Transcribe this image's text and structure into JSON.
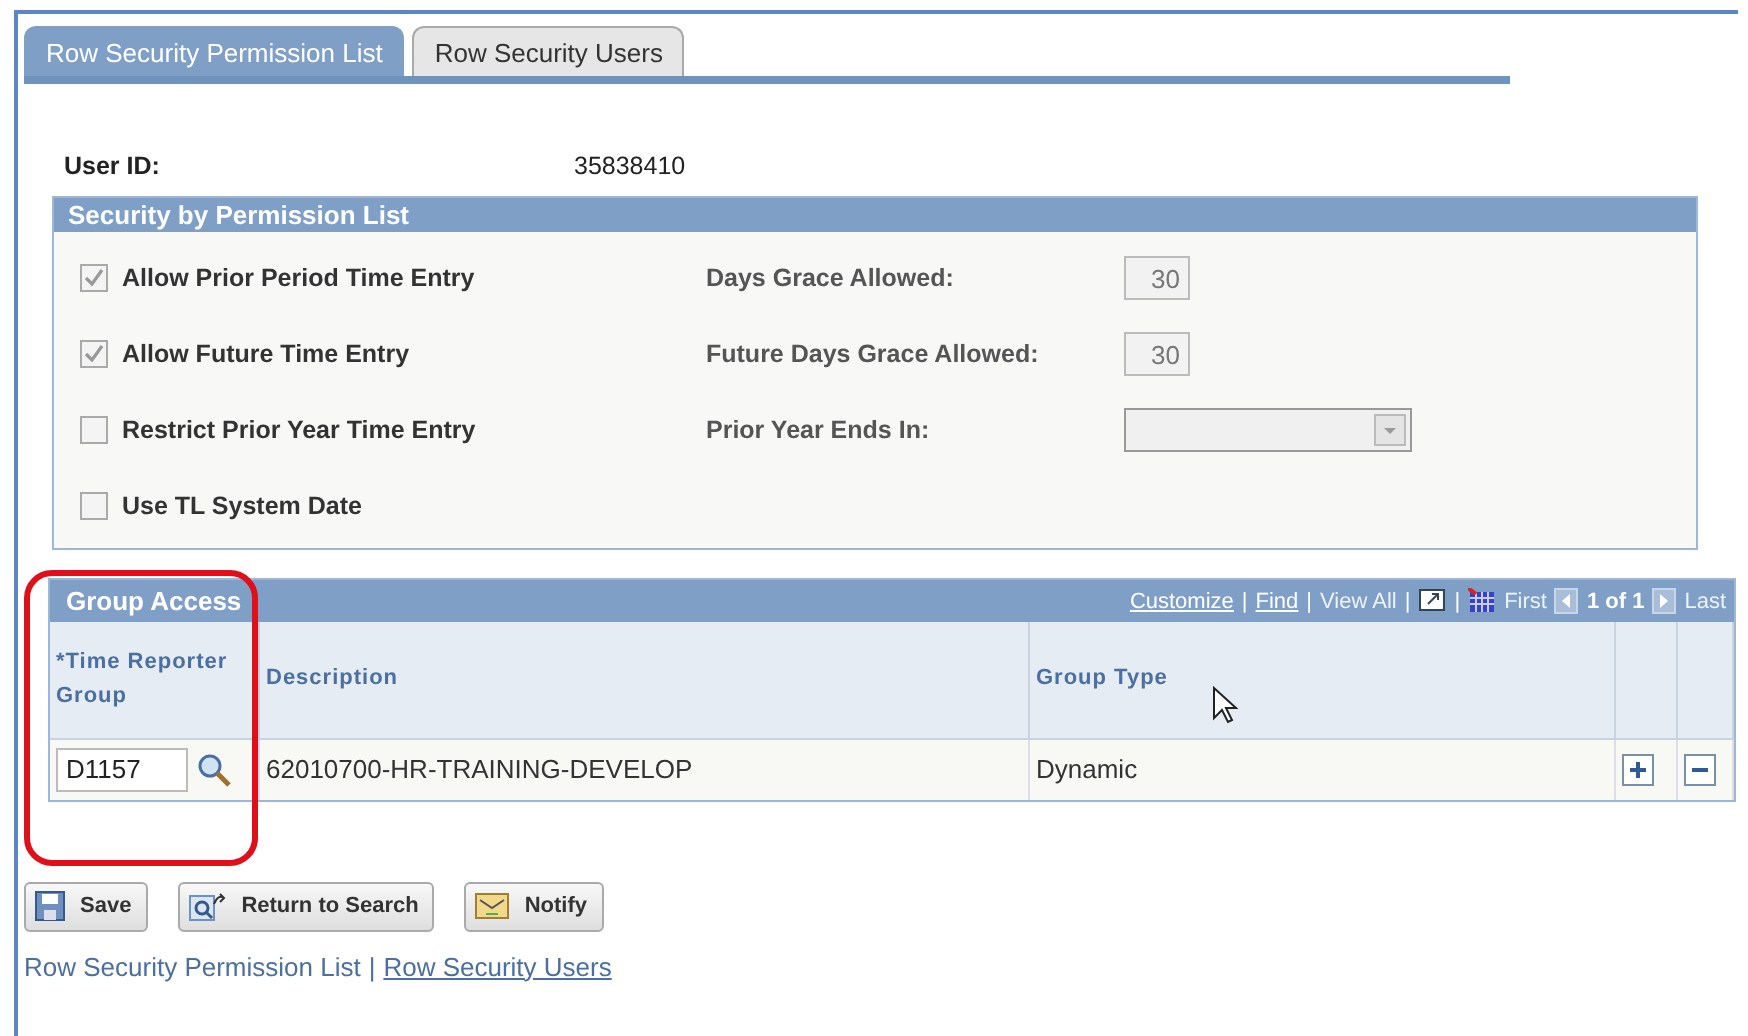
{
  "tabs": [
    {
      "label": "Row Security Permission List",
      "selected": true
    },
    {
      "label": "Row Security Users",
      "selected": false
    }
  ],
  "user_id": {
    "label": "User ID:",
    "value": "35838410"
  },
  "permission_section": {
    "title": "Security by Permission List",
    "rows": [
      {
        "label": "Allow Prior Period Time Entry",
        "checked": true,
        "field": {
          "kind": "input",
          "label": "Days Grace Allowed:",
          "value": "30",
          "disabled": true
        }
      },
      {
        "label": "Allow Future Time Entry",
        "checked": true,
        "field": {
          "kind": "input",
          "label": "Future Days Grace Allowed:",
          "value": "30",
          "disabled": true
        }
      },
      {
        "label": "Restrict Prior Year Time Entry",
        "checked": false,
        "field": {
          "kind": "select",
          "label": "Prior Year Ends In:",
          "disabled": true
        }
      },
      {
        "label": "Use TL System Date",
        "checked": false
      }
    ]
  },
  "group_access": {
    "title": "Group Access",
    "nav": [
      {
        "kind": "link",
        "text": "Customize"
      },
      {
        "kind": "sep",
        "text": "|"
      },
      {
        "kind": "link",
        "text": "Find"
      },
      {
        "kind": "sep",
        "text": "|"
      },
      {
        "kind": "disabled",
        "text": "View All"
      },
      {
        "kind": "sep",
        "text": "|"
      },
      {
        "kind": "zoom-icon"
      },
      {
        "kind": "sep",
        "text": "|"
      },
      {
        "kind": "grid-icon"
      },
      {
        "kind": "disabled",
        "text": "First"
      },
      {
        "kind": "prev-icon"
      },
      {
        "kind": "count",
        "text": "1 of 1"
      },
      {
        "kind": "next-icon"
      },
      {
        "kind": "disabled",
        "text": "Last"
      }
    ],
    "columns": [
      "*Time Reporter Group",
      "Description",
      "Group Type"
    ],
    "rows": [
      {
        "time_reporter_group": "D1157",
        "description": "62010700-HR-TRAINING-DEVELOP",
        "group_type": "Dynamic"
      }
    ]
  },
  "buttons": [
    {
      "kind": "save",
      "label": "Save"
    },
    {
      "kind": "return",
      "label": "Return to Search"
    },
    {
      "kind": "notify",
      "label": "Notify"
    }
  ],
  "footer_links": [
    {
      "kind": "current",
      "text": "Row Security Permission List"
    },
    {
      "kind": "sep",
      "text": "|"
    },
    {
      "kind": "link",
      "text": "Row Security Users"
    }
  ]
}
